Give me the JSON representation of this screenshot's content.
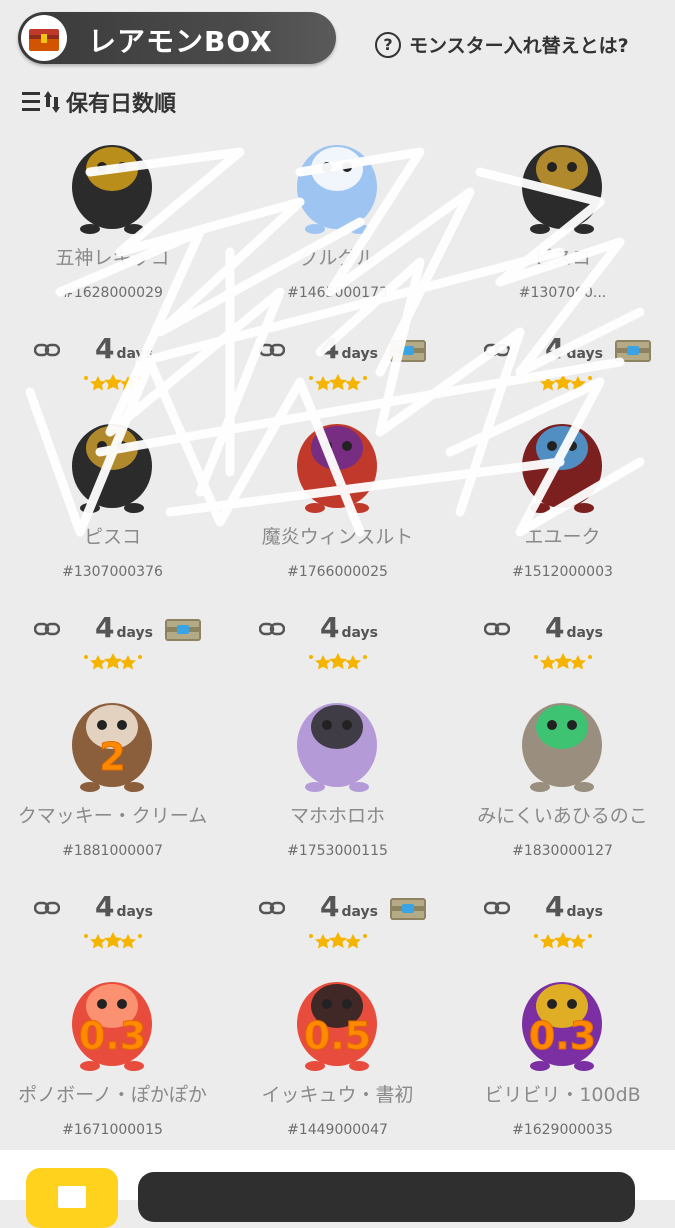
{
  "header": {
    "title": "レアモンBOX",
    "help_text": "モンスター入れ替えとは?",
    "help_icon_glyph": "?",
    "sort_label": "保有日数順"
  },
  "colors": {
    "overlay_number": "#ff8a00",
    "accent_yellow": "#ffd21e",
    "star": "#f5b400"
  },
  "monsters": [
    {
      "name": "五神レキッコ",
      "serial": "#1628000029",
      "days": "",
      "days_unit": "",
      "has_chest": false,
      "overlay": ""
    },
    {
      "name": "グルグル",
      "serial": "#1465000173",
      "days": "",
      "days_unit": "",
      "has_chest": false,
      "overlay": ""
    },
    {
      "name": "ピスコ",
      "serial": "#1307000...",
      "days": "",
      "days_unit": "",
      "has_chest": false,
      "overlay": ""
    },
    {
      "name": "ピスコ",
      "serial": "#1307000376",
      "days": "4",
      "days_unit": "days",
      "has_chest": false,
      "overlay": ""
    },
    {
      "name": "魔炎ウィンスルト",
      "serial": "#1766000025",
      "days": "4",
      "days_unit": "days",
      "has_chest": true,
      "overlay": ""
    },
    {
      "name": "エユーク",
      "serial": "#1512000003",
      "days": "4",
      "days_unit": "days",
      "has_chest": true,
      "overlay": ""
    },
    {
      "name": "クマッキー・クリーム",
      "serial": "#1881000007",
      "days": "4",
      "days_unit": "days",
      "has_chest": true,
      "overlay": "2"
    },
    {
      "name": "マホホロホ",
      "serial": "#1753000115",
      "days": "4",
      "days_unit": "days",
      "has_chest": false,
      "overlay": ""
    },
    {
      "name": "みにくいあひるのこ",
      "serial": "#1830000127",
      "days": "4",
      "days_unit": "days",
      "has_chest": false,
      "overlay": ""
    },
    {
      "name": "ポノボーノ・ぽかぽか",
      "serial": "#1671000015",
      "days": "4",
      "days_unit": "days",
      "has_chest": false,
      "overlay": "0.3"
    },
    {
      "name": "イッキュウ・書初",
      "serial": "#1449000047",
      "days": "4",
      "days_unit": "days",
      "has_chest": true,
      "overlay": "0.5"
    },
    {
      "name": "ビリビリ・100dB",
      "serial": "#1629000035",
      "days": "4",
      "days_unit": "days",
      "has_chest": false,
      "overlay": "0.3"
    }
  ]
}
